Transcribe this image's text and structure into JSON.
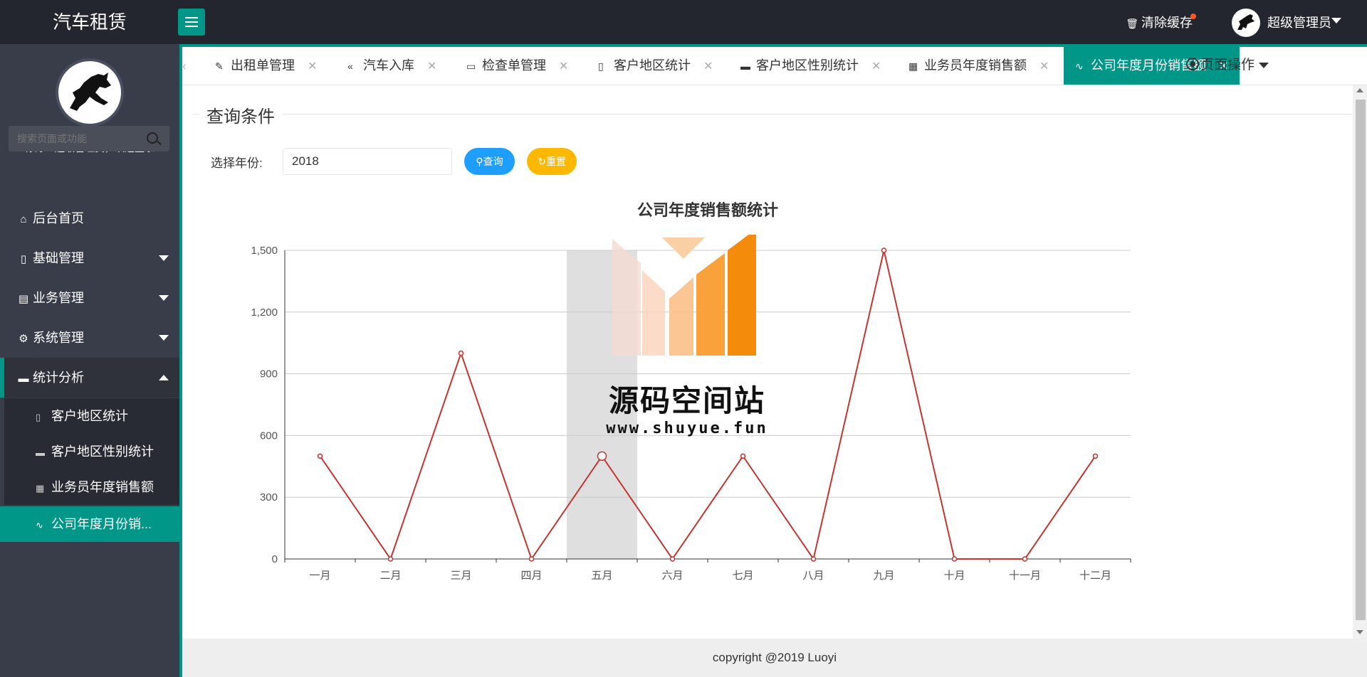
{
  "app": {
    "title": "汽车租赁"
  },
  "header": {
    "clear_cache": "清除缓存",
    "user_name": "超级管理员"
  },
  "sidebar": {
    "welcome": "你好！超级管理员，欢迎登录",
    "search_placeholder": "搜索页面或功能",
    "items": [
      {
        "label": "后台首页",
        "icon": "home-icon"
      },
      {
        "label": "基础管理",
        "icon": "file-icon"
      },
      {
        "label": "业务管理",
        "icon": "building-icon"
      },
      {
        "label": "系统管理",
        "icon": "gear-icon"
      },
      {
        "label": "统计分析",
        "icon": "monitor-icon"
      }
    ],
    "sub_items": [
      {
        "label": "客户地区统计",
        "icon": "clipboard-icon"
      },
      {
        "label": "客户地区性别统计",
        "icon": "monitor-icon"
      },
      {
        "label": "业务员年度销售额",
        "icon": "table-icon"
      },
      {
        "label": "公司年度月份销...",
        "icon": "pulse-icon"
      }
    ]
  },
  "tabs": [
    {
      "label": "出租单管理",
      "icon": "edit-icon"
    },
    {
      "label": "汽车入库",
      "icon": "double-chevron-left-icon"
    },
    {
      "label": "检查单管理",
      "icon": "book-icon"
    },
    {
      "label": "客户地区统计",
      "icon": "clipboard-icon"
    },
    {
      "label": "客户地区性别统计",
      "icon": "monitor-icon"
    },
    {
      "label": "业务员年度销售额",
      "icon": "table-icon"
    },
    {
      "label": "公司年度月份销售额",
      "icon": "pulse-icon"
    }
  ],
  "page_operations": "页面操作",
  "query": {
    "legend": "查询条件",
    "year_label": "选择年份:",
    "year_value": "2018",
    "query_button": "查询",
    "reset_button": "重置"
  },
  "footer": {
    "copyright": "copyright @2019 Luoyi"
  },
  "watermark": {
    "title": "源码空间站",
    "url": "www.shuyue.fun"
  },
  "colors": {
    "accent": "#009688",
    "query_blue": "#1e9fff",
    "reset_yellow": "#ffb800",
    "series_line": "#c23531"
  },
  "chart_data": {
    "type": "line",
    "title": "公司年度销售额统计",
    "categories": [
      "一月",
      "二月",
      "三月",
      "四月",
      "五月",
      "六月",
      "七月",
      "八月",
      "九月",
      "十月",
      "十一月",
      "十二月"
    ],
    "series": [
      {
        "values": [
          500,
          0,
          1000,
          0,
          500,
          0,
          500,
          0,
          1500,
          0,
          0,
          500
        ]
      }
    ],
    "yticks": [
      "0",
      "300",
      "600",
      "900",
      "1,200",
      "1,500"
    ],
    "ylim": [
      0,
      1500
    ],
    "grid": true,
    "highlighted_category": "五月"
  }
}
